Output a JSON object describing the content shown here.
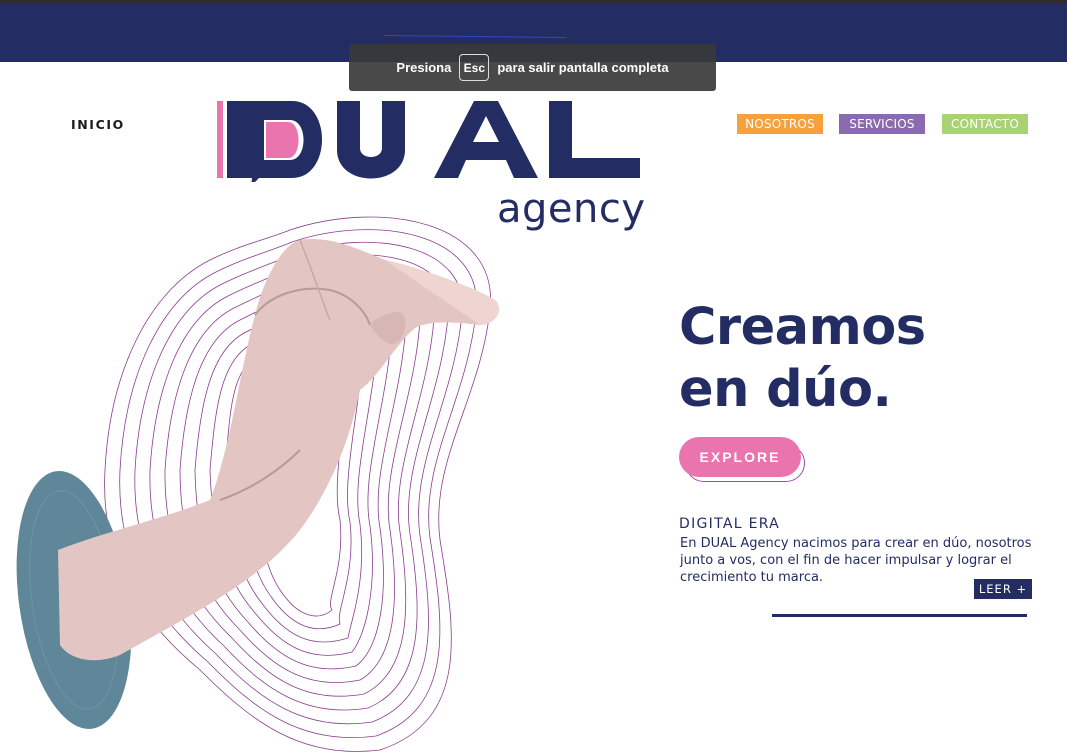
{
  "fullscreen_toast": {
    "prefix": "Presiona",
    "key": "Esc",
    "suffix": "para salir pantalla completa"
  },
  "nav": {
    "inicio": "INICIO",
    "nosotros": "NOSOTROS",
    "servicios": "SERVICIOS",
    "contacto": "CONTACTO"
  },
  "logo": {
    "wordmark": "DUAL",
    "subtitle": "agency"
  },
  "hero": {
    "headline_line1": "Creamos",
    "headline_line2": "en dúo.",
    "cta": "EXPLORE",
    "section_label": "DIGITAL ERA",
    "body": "En DUAL Agency nacimos para crear en dúo, nosotros junto a vos, con el fin de hacer impulsar y lograr el crecimiento tu marca.",
    "read_more": "LEER +"
  },
  "colors": {
    "navy": "#232d63",
    "pink": "#ea74ad",
    "orange": "#f7a13c",
    "purple": "#8a6bb0",
    "green": "#a9d373",
    "teal_portal": "#5f8799",
    "contour": "#8a3d8e"
  },
  "icons": {
    "portal": "blue-oval-portal",
    "hand": "reaching-hand-illustration",
    "waves": "contour-lines-pattern"
  }
}
